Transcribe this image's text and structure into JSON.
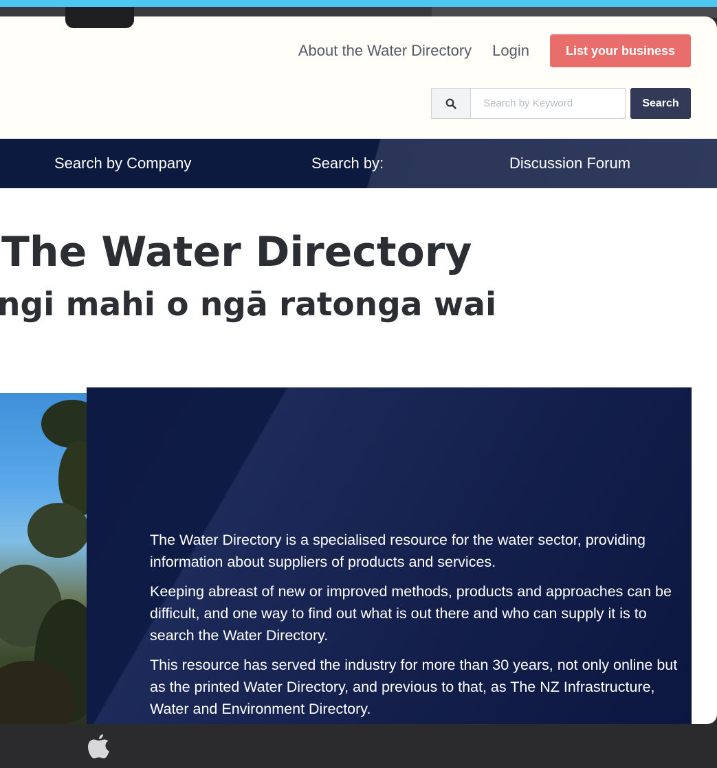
{
  "header": {
    "links": {
      "about": "About the Water Directory",
      "login": "Login"
    },
    "list_business_label": "List your business",
    "search": {
      "icon": "search-icon",
      "placeholder": "Search by Keyword",
      "button_label": "Search"
    }
  },
  "nav": {
    "items": [
      "Search by Company",
      "Search by:",
      "Discussion Forum"
    ]
  },
  "main": {
    "title": "The Water Directory",
    "subtitle": "ngi mahi o ngā ratonga wai",
    "paragraphs": [
      "The Water Directory is a specialised resource for the water sector, providing information about suppliers of products and services.",
      "Keeping abreast of new or improved methods, products and approaches can be difficult, and one way to find out what is out there and who can supply it is to search the Water Directory.",
      "This resource has served the industry for more than 30 years, not only online but as the printed Water Directory, and previous to that, as The NZ Infrastructure, Water and Environment Directory."
    ]
  },
  "colors": {
    "accent": "#e96e6b",
    "nav_dark": "#0b1a3e",
    "search_button": "#333a57",
    "top_bar": "#4cc8f0"
  },
  "device": {
    "logo_icon": "apple-icon"
  }
}
